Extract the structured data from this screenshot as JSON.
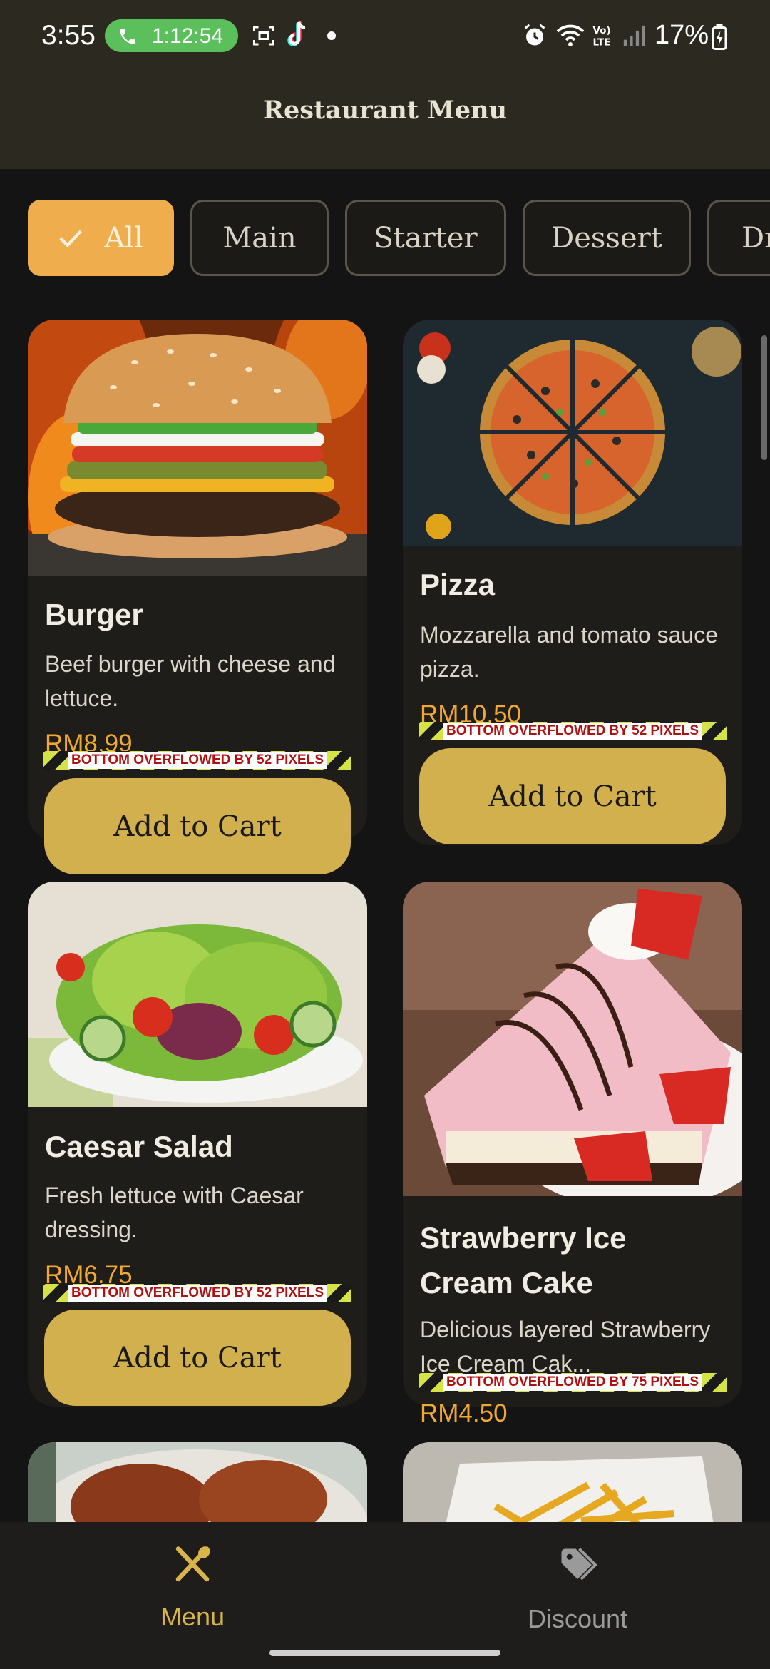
{
  "status_bar": {
    "time": "3:55",
    "call_timer": "1:12:54",
    "battery": "17%"
  },
  "app_bar": {
    "title": "Restaurant Menu"
  },
  "filters": [
    {
      "label": "All",
      "selected": true
    },
    {
      "label": "Main",
      "selected": false
    },
    {
      "label": "Starter",
      "selected": false
    },
    {
      "label": "Dessert",
      "selected": false
    },
    {
      "label": "Dr",
      "selected": false
    }
  ],
  "menu_items": [
    {
      "name": "Burger",
      "description": "Beef burger with cheese and lettuce.",
      "price": "RM8.99",
      "overflow_text": "BOTTOM OVERFLOWED BY 52 PIXELS",
      "button": "Add to Cart"
    },
    {
      "name": "Pizza",
      "description": "Mozzarella and tomato sauce pizza.",
      "price": "RM10.50",
      "overflow_text": "BOTTOM OVERFLOWED BY 52 PIXELS",
      "button": "Add to Cart"
    },
    {
      "name": "Caesar Salad",
      "description": "Fresh lettuce with Caesar dressing.",
      "price": "RM6.75",
      "overflow_text": "BOTTOM OVERFLOWED BY 52 PIXELS",
      "button": "Add to Cart"
    },
    {
      "name": "Strawberry Ice Cream Cake",
      "description": "Delicious layered Strawberry Ice Cream Cak...",
      "price": "RM4.50",
      "overflow_text": "BOTTOM OVERFLOWED BY 75 PIXELS"
    }
  ],
  "bottom_nav": [
    {
      "label": "Menu",
      "icon": "utensils-icon",
      "active": true
    },
    {
      "label": "Discount",
      "icon": "tag-icon",
      "active": false
    }
  ],
  "colors": {
    "accent_orange": "#f0ad4e",
    "button_gold": "#d3b04e",
    "price": "#f0a830",
    "nav_active": "#d9b44a",
    "nav_inactive": "#9a9a9a"
  }
}
